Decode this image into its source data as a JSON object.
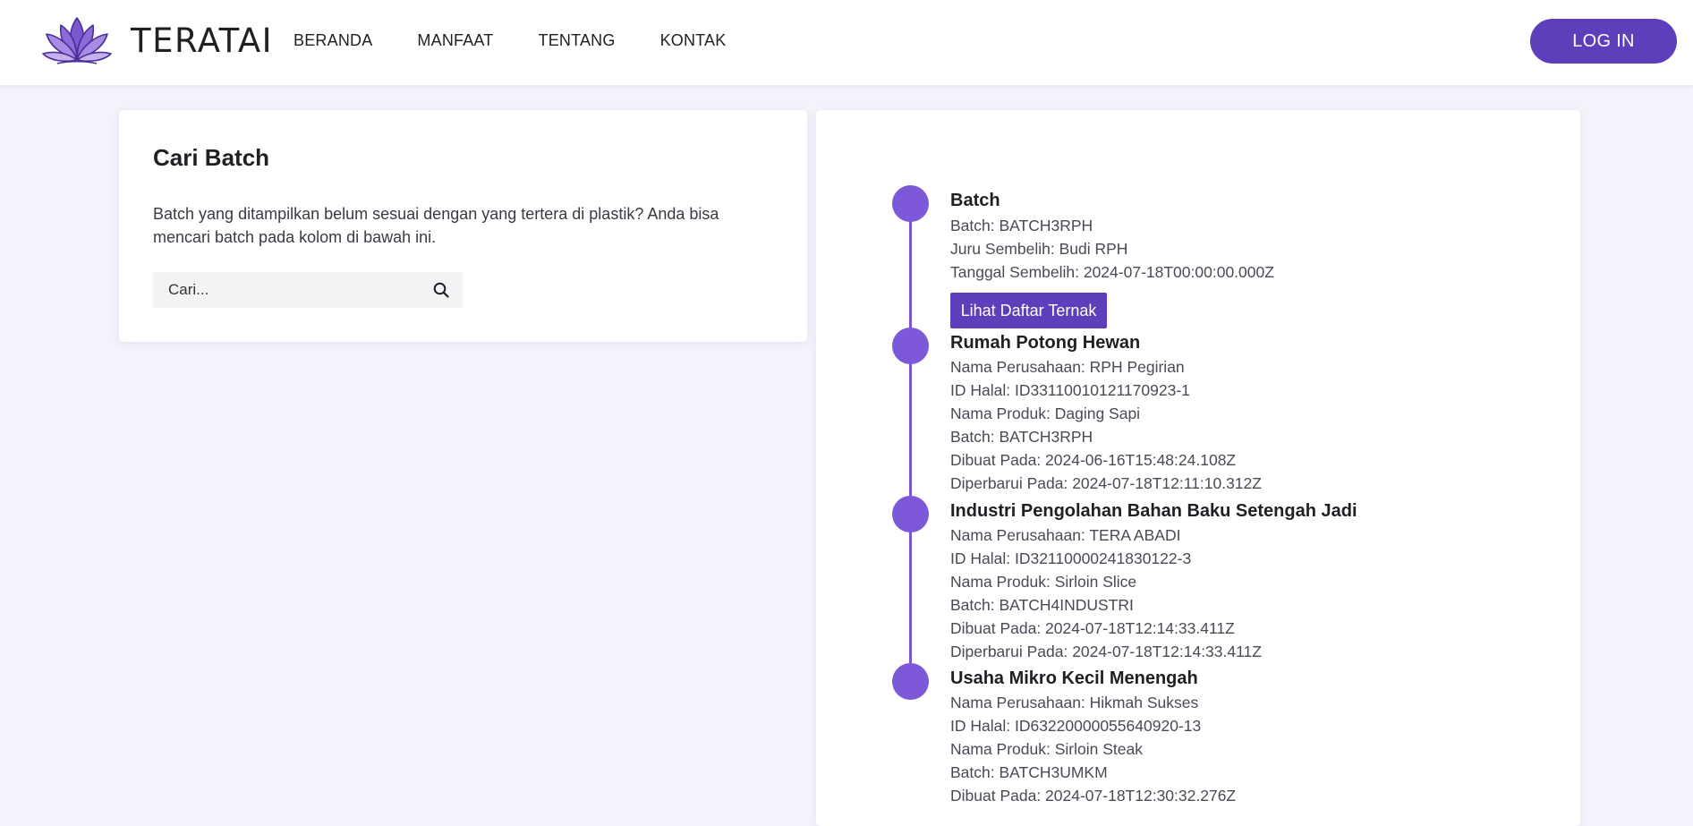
{
  "header": {
    "brand": "TERATAI",
    "nav": [
      "BERANDA",
      "MANFAAT",
      "TENTANG",
      "KONTAK"
    ],
    "login_label": "LOG IN"
  },
  "search": {
    "title": "Cari Batch",
    "description": "Batch yang ditampilkan belum sesuai dengan yang tertera di plastik? Anda bisa mencari batch pada kolom di bawah ini.",
    "placeholder": "Cari..."
  },
  "timeline": {
    "button_label": "Lihat Daftar Ternak",
    "items": [
      {
        "title": "Batch",
        "lines": [
          "Batch: BATCH3RPH",
          "Juru Sembelih: Budi RPH",
          "Tanggal Sembelih: 2024-07-18T00:00:00.000Z"
        ]
      },
      {
        "title": "Rumah Potong Hewan",
        "lines": [
          "Nama Perusahaan: RPH Pegirian",
          "ID Halal: ID33110010121170923-1",
          "Nama Produk: Daging Sapi",
          "Batch: BATCH3RPH",
          "Dibuat Pada: 2024-06-16T15:48:24.108Z",
          "Diperbarui Pada: 2024-07-18T12:11:10.312Z"
        ]
      },
      {
        "title": "Industri Pengolahan Bahan Baku Setengah Jadi",
        "lines": [
          "Nama Perusahaan: TERA ABADI",
          "ID Halal: ID32110000241830122-3",
          "Nama Produk: Sirloin Slice",
          "Batch: BATCH4INDUSTRI",
          "Dibuat Pada: 2024-07-18T12:14:33.411Z",
          "Diperbarui Pada: 2024-07-18T12:14:33.411Z"
        ]
      },
      {
        "title": "Usaha Mikro Kecil Menengah",
        "lines": [
          "Nama Perusahaan: Hikmah Sukses",
          "ID Halal: ID63220000055640920-13",
          "Nama Produk: Sirloin Steak",
          "Batch: BATCH3UMKM",
          "Dibuat Pada: 2024-07-18T12:30:32.276Z"
        ]
      }
    ]
  },
  "colors": {
    "accent": "#5e3fbb",
    "timeline_dot": "#7d58d8",
    "page_bg": "#f4f3fb"
  },
  "icons": [
    "lotus-logo-icon",
    "search-icon"
  ]
}
